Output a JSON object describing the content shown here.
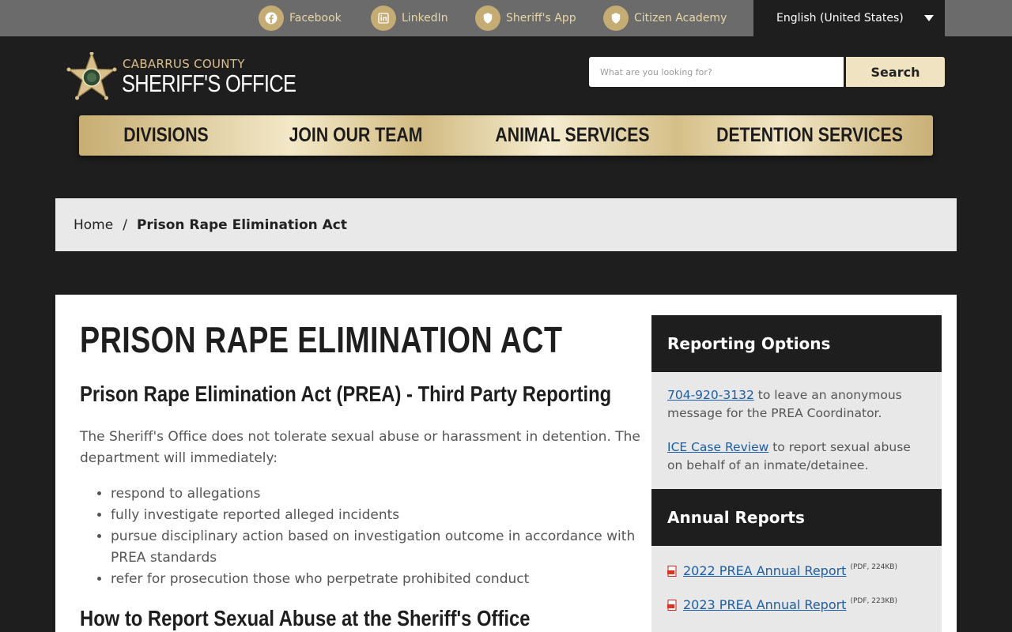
{
  "topbar": {
    "links": [
      {
        "label": "Facebook",
        "icon": "facebook-icon"
      },
      {
        "label": "LinkedIn",
        "icon": "linkedin-icon"
      },
      {
        "label": "Sheriff's App",
        "icon": "shield-icon"
      },
      {
        "label": "Citizen Academy",
        "icon": "shield-icon"
      }
    ],
    "language": "English (United States)"
  },
  "logo": {
    "line1": "CABARRUS COUNTY",
    "line2": "SHERIFF'S OFFICE"
  },
  "search": {
    "placeholder": "What are you looking for?",
    "button": "Search"
  },
  "nav": {
    "items": [
      "DIVISIONS",
      "JOIN OUR TEAM",
      "ANIMAL SERVICES",
      "DETENTION SERVICES"
    ]
  },
  "breadcrumb": {
    "home": "Home",
    "separator": "/",
    "current": "Prison Rape Elimination Act"
  },
  "main": {
    "title": "PRISON RAPE ELIMINATION ACT",
    "heading1": "Prison Rape Elimination Act (PREA) - Third Party Reporting",
    "intro": "The Sheriff's Office does not tolerate sexual abuse or harassment in detention. The department will immediately:",
    "bullets": [
      "respond to allegations",
      "fully investigate reported alleged incidents",
      "pursue disciplinary action based on investigation outcome in accordance with PREA standards",
      "refer for prosecution those who perpetrate prohibited conduct"
    ],
    "heading2": "How to Report Sexual Abuse at the Sheriff's Office"
  },
  "sidebar": {
    "reporting": {
      "title": "Reporting Options",
      "phone_link": "704-920-3132",
      "phone_text": " to leave an anonymous message for the PREA Coordinator.",
      "ice_link": "ICE Case Review",
      "ice_text": " to report sexual abuse on behalf of an inmate/detainee."
    },
    "annual": {
      "title": "Annual Reports",
      "reports": [
        {
          "label": "2022 PREA Annual Report",
          "meta": "(PDF, 224KB)"
        },
        {
          "label": "2023 PREA Annual Report",
          "meta": "(PDF, 223KB)"
        }
      ]
    }
  },
  "colors": {
    "gold": "#c4ac72",
    "dark": "#1e1e1e",
    "link": "#1a5ea8"
  }
}
